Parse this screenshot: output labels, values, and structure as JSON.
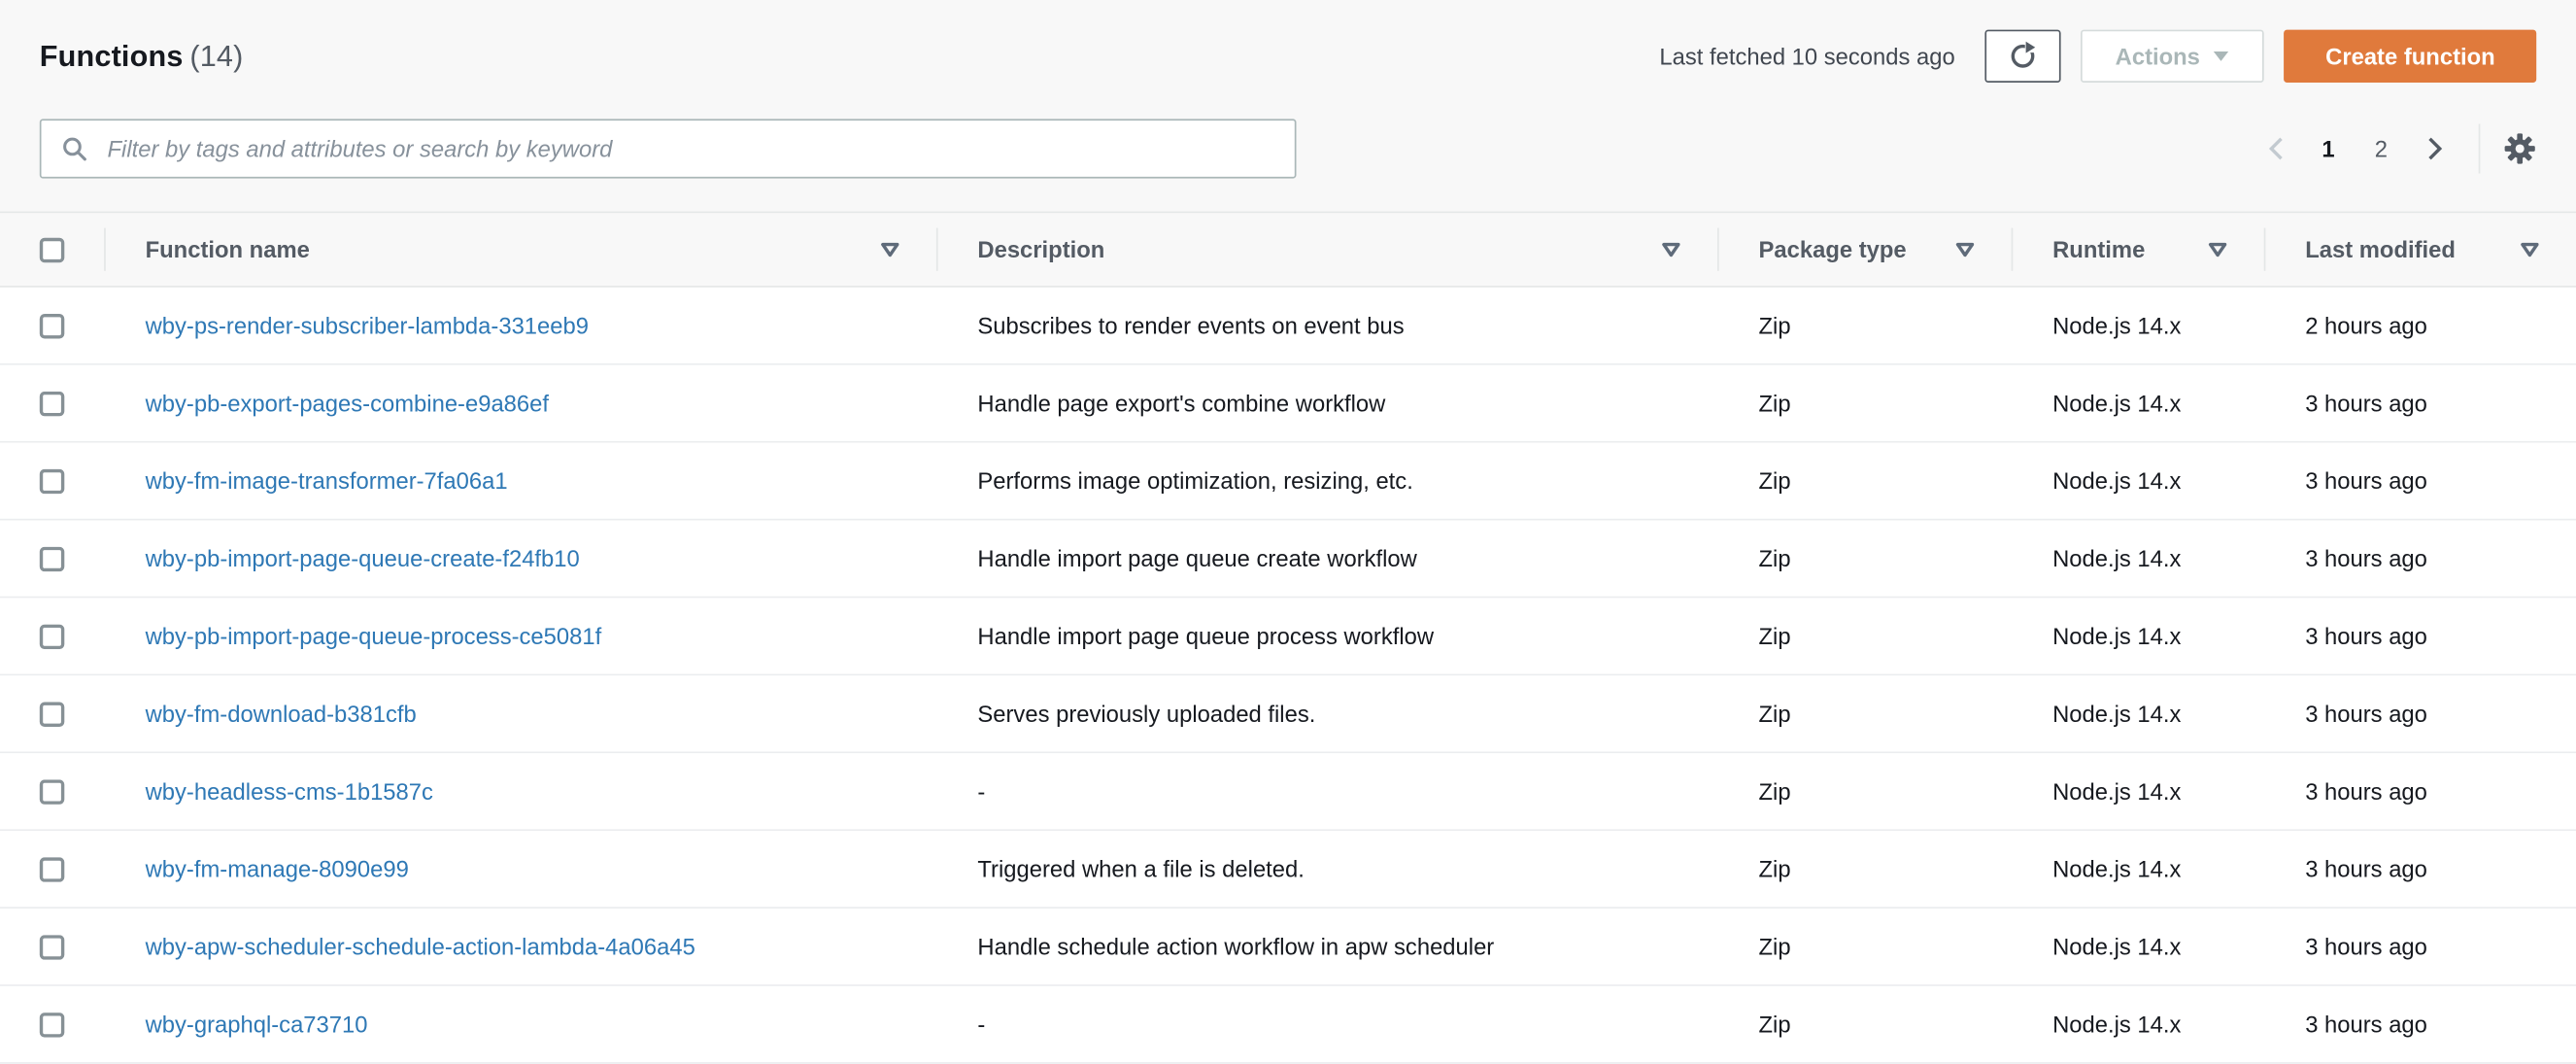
{
  "header": {
    "title": "Functions",
    "count": "(14)",
    "last_fetched": "Last fetched 10 seconds ago",
    "actions_label": "Actions",
    "create_label": "Create function"
  },
  "search": {
    "placeholder": "Filter by tags and attributes or search by keyword",
    "value": ""
  },
  "pagination": {
    "pages": [
      "1",
      "2"
    ],
    "current_page": "1"
  },
  "table": {
    "columns": [
      "Function name",
      "Description",
      "Package type",
      "Runtime",
      "Last modified"
    ],
    "rows": [
      {
        "name": "wby-ps-render-subscriber-lambda-331eeb9",
        "description": "Subscribes to render events on event bus",
        "package_type": "Zip",
        "runtime": "Node.js 14.x",
        "last_modified": "2 hours ago"
      },
      {
        "name": "wby-pb-export-pages-combine-e9a86ef",
        "description": "Handle page export's combine workflow",
        "package_type": "Zip",
        "runtime": "Node.js 14.x",
        "last_modified": "3 hours ago"
      },
      {
        "name": "wby-fm-image-transformer-7fa06a1",
        "description": "Performs image optimization, resizing, etc.",
        "package_type": "Zip",
        "runtime": "Node.js 14.x",
        "last_modified": "3 hours ago"
      },
      {
        "name": "wby-pb-import-page-queue-create-f24fb10",
        "description": "Handle import page queue create workflow",
        "package_type": "Zip",
        "runtime": "Node.js 14.x",
        "last_modified": "3 hours ago"
      },
      {
        "name": "wby-pb-import-page-queue-process-ce5081f",
        "description": "Handle import page queue process workflow",
        "package_type": "Zip",
        "runtime": "Node.js 14.x",
        "last_modified": "3 hours ago"
      },
      {
        "name": "wby-fm-download-b381cfb",
        "description": "Serves previously uploaded files.",
        "package_type": "Zip",
        "runtime": "Node.js 14.x",
        "last_modified": "3 hours ago"
      },
      {
        "name": "wby-headless-cms-1b1587c",
        "description": "-",
        "package_type": "Zip",
        "runtime": "Node.js 14.x",
        "last_modified": "3 hours ago"
      },
      {
        "name": "wby-fm-manage-8090e99",
        "description": "Triggered when a file is deleted.",
        "package_type": "Zip",
        "runtime": "Node.js 14.x",
        "last_modified": "3 hours ago"
      },
      {
        "name": "wby-apw-scheduler-schedule-action-lambda-4a06a45",
        "description": "Handle schedule action workflow in apw scheduler",
        "package_type": "Zip",
        "runtime": "Node.js 14.x",
        "last_modified": "3 hours ago"
      },
      {
        "name": "wby-graphql-ca73710",
        "description": "-",
        "package_type": "Zip",
        "runtime": "Node.js 14.x",
        "last_modified": "3 hours ago"
      }
    ]
  },
  "colors": {
    "primary_button": "#e07a3c",
    "link": "#2e78b5",
    "header_text": "#545b64",
    "body_text": "#16191f",
    "border": "#e4e7e7",
    "row_border": "#ebedef",
    "page_bg": "#f8f8f8",
    "disabled_text": "#aab7b8",
    "icon": "#545b64"
  }
}
